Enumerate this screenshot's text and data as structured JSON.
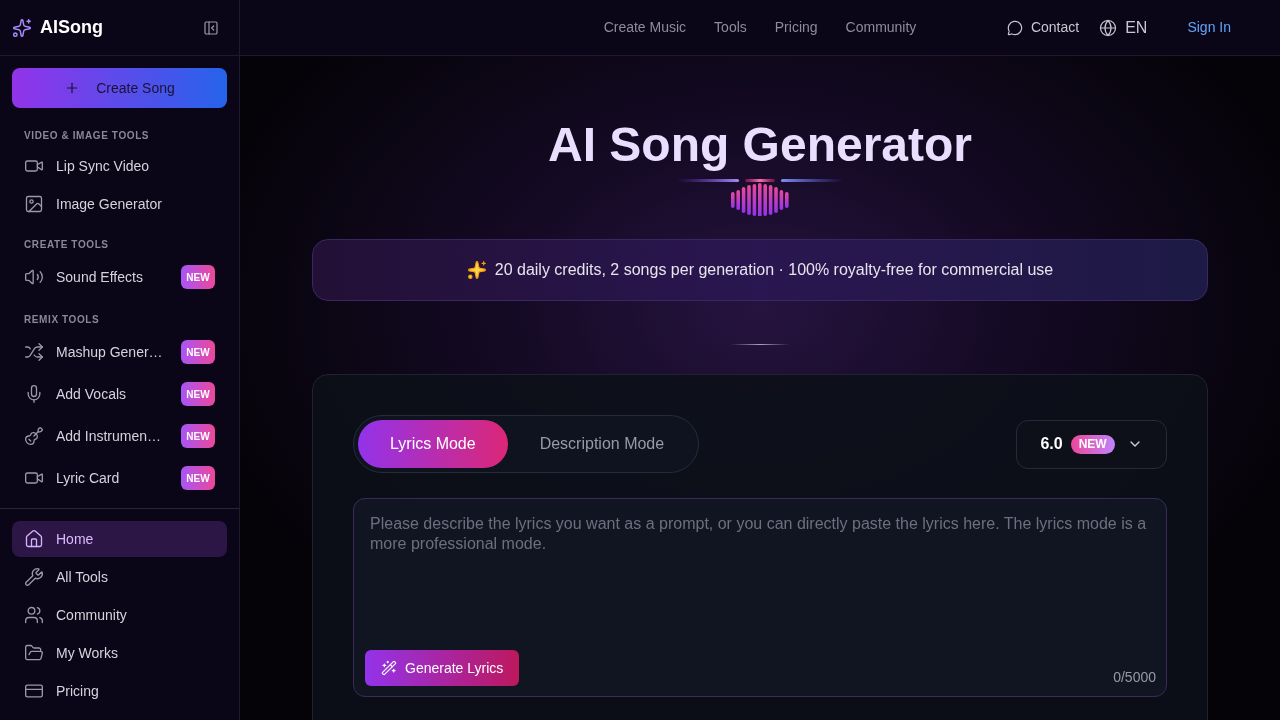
{
  "sidebar": {
    "logo": "AISong",
    "create_button": "Create Song",
    "sections": [
      {
        "title": "VIDEO & IMAGE TOOLS",
        "items": [
          {
            "label": "Lip Sync Video",
            "selected": false
          },
          {
            "label": "Image Generator",
            "selected": false
          }
        ]
      },
      {
        "title": "CREATE TOOLS",
        "items": [
          {
            "label": "Sound Effects",
            "badge": "NEW",
            "selected": false
          }
        ]
      },
      {
        "title": "REMIX TOOLS",
        "items": [
          {
            "label": "Mashup Gener…",
            "badge": "NEW",
            "selected": false
          },
          {
            "label": "Add Vocals",
            "badge": "NEW",
            "selected": false
          },
          {
            "label": "Add Instrumen…",
            "badge": "NEW",
            "selected": false
          },
          {
            "label": "Lyric Card",
            "badge": "NEW",
            "selected": false
          }
        ]
      }
    ],
    "nav": [
      {
        "label": "Home",
        "selected": true
      },
      {
        "label": "All Tools",
        "selected": false
      },
      {
        "label": "Community",
        "selected": false
      },
      {
        "label": "My Works",
        "selected": false
      },
      {
        "label": "Pricing",
        "selected": false
      }
    ]
  },
  "header": {
    "nav": [
      "Create Music",
      "Tools",
      "Pricing",
      "Community"
    ],
    "contact": "Contact",
    "language": "EN",
    "sign_in": "Sign In"
  },
  "hero": {
    "title": "AI Song Generator",
    "banner": "20 daily credits, 2 songs per generation · 100% royalty-free for commercial use"
  },
  "generator": {
    "modes": [
      {
        "label": "Lyrics Mode",
        "selected": true
      },
      {
        "label": "Description Mode",
        "selected": false
      }
    ],
    "version": {
      "value": "6.0",
      "badge": "NEW"
    },
    "lyrics": {
      "placeholder": "Please describe the lyrics you want as a prompt, or you can directly paste the lyrics here. The lyrics mode is a more professional mode.",
      "counter": "0/5000"
    },
    "generate_button": "Generate Lyrics"
  }
}
